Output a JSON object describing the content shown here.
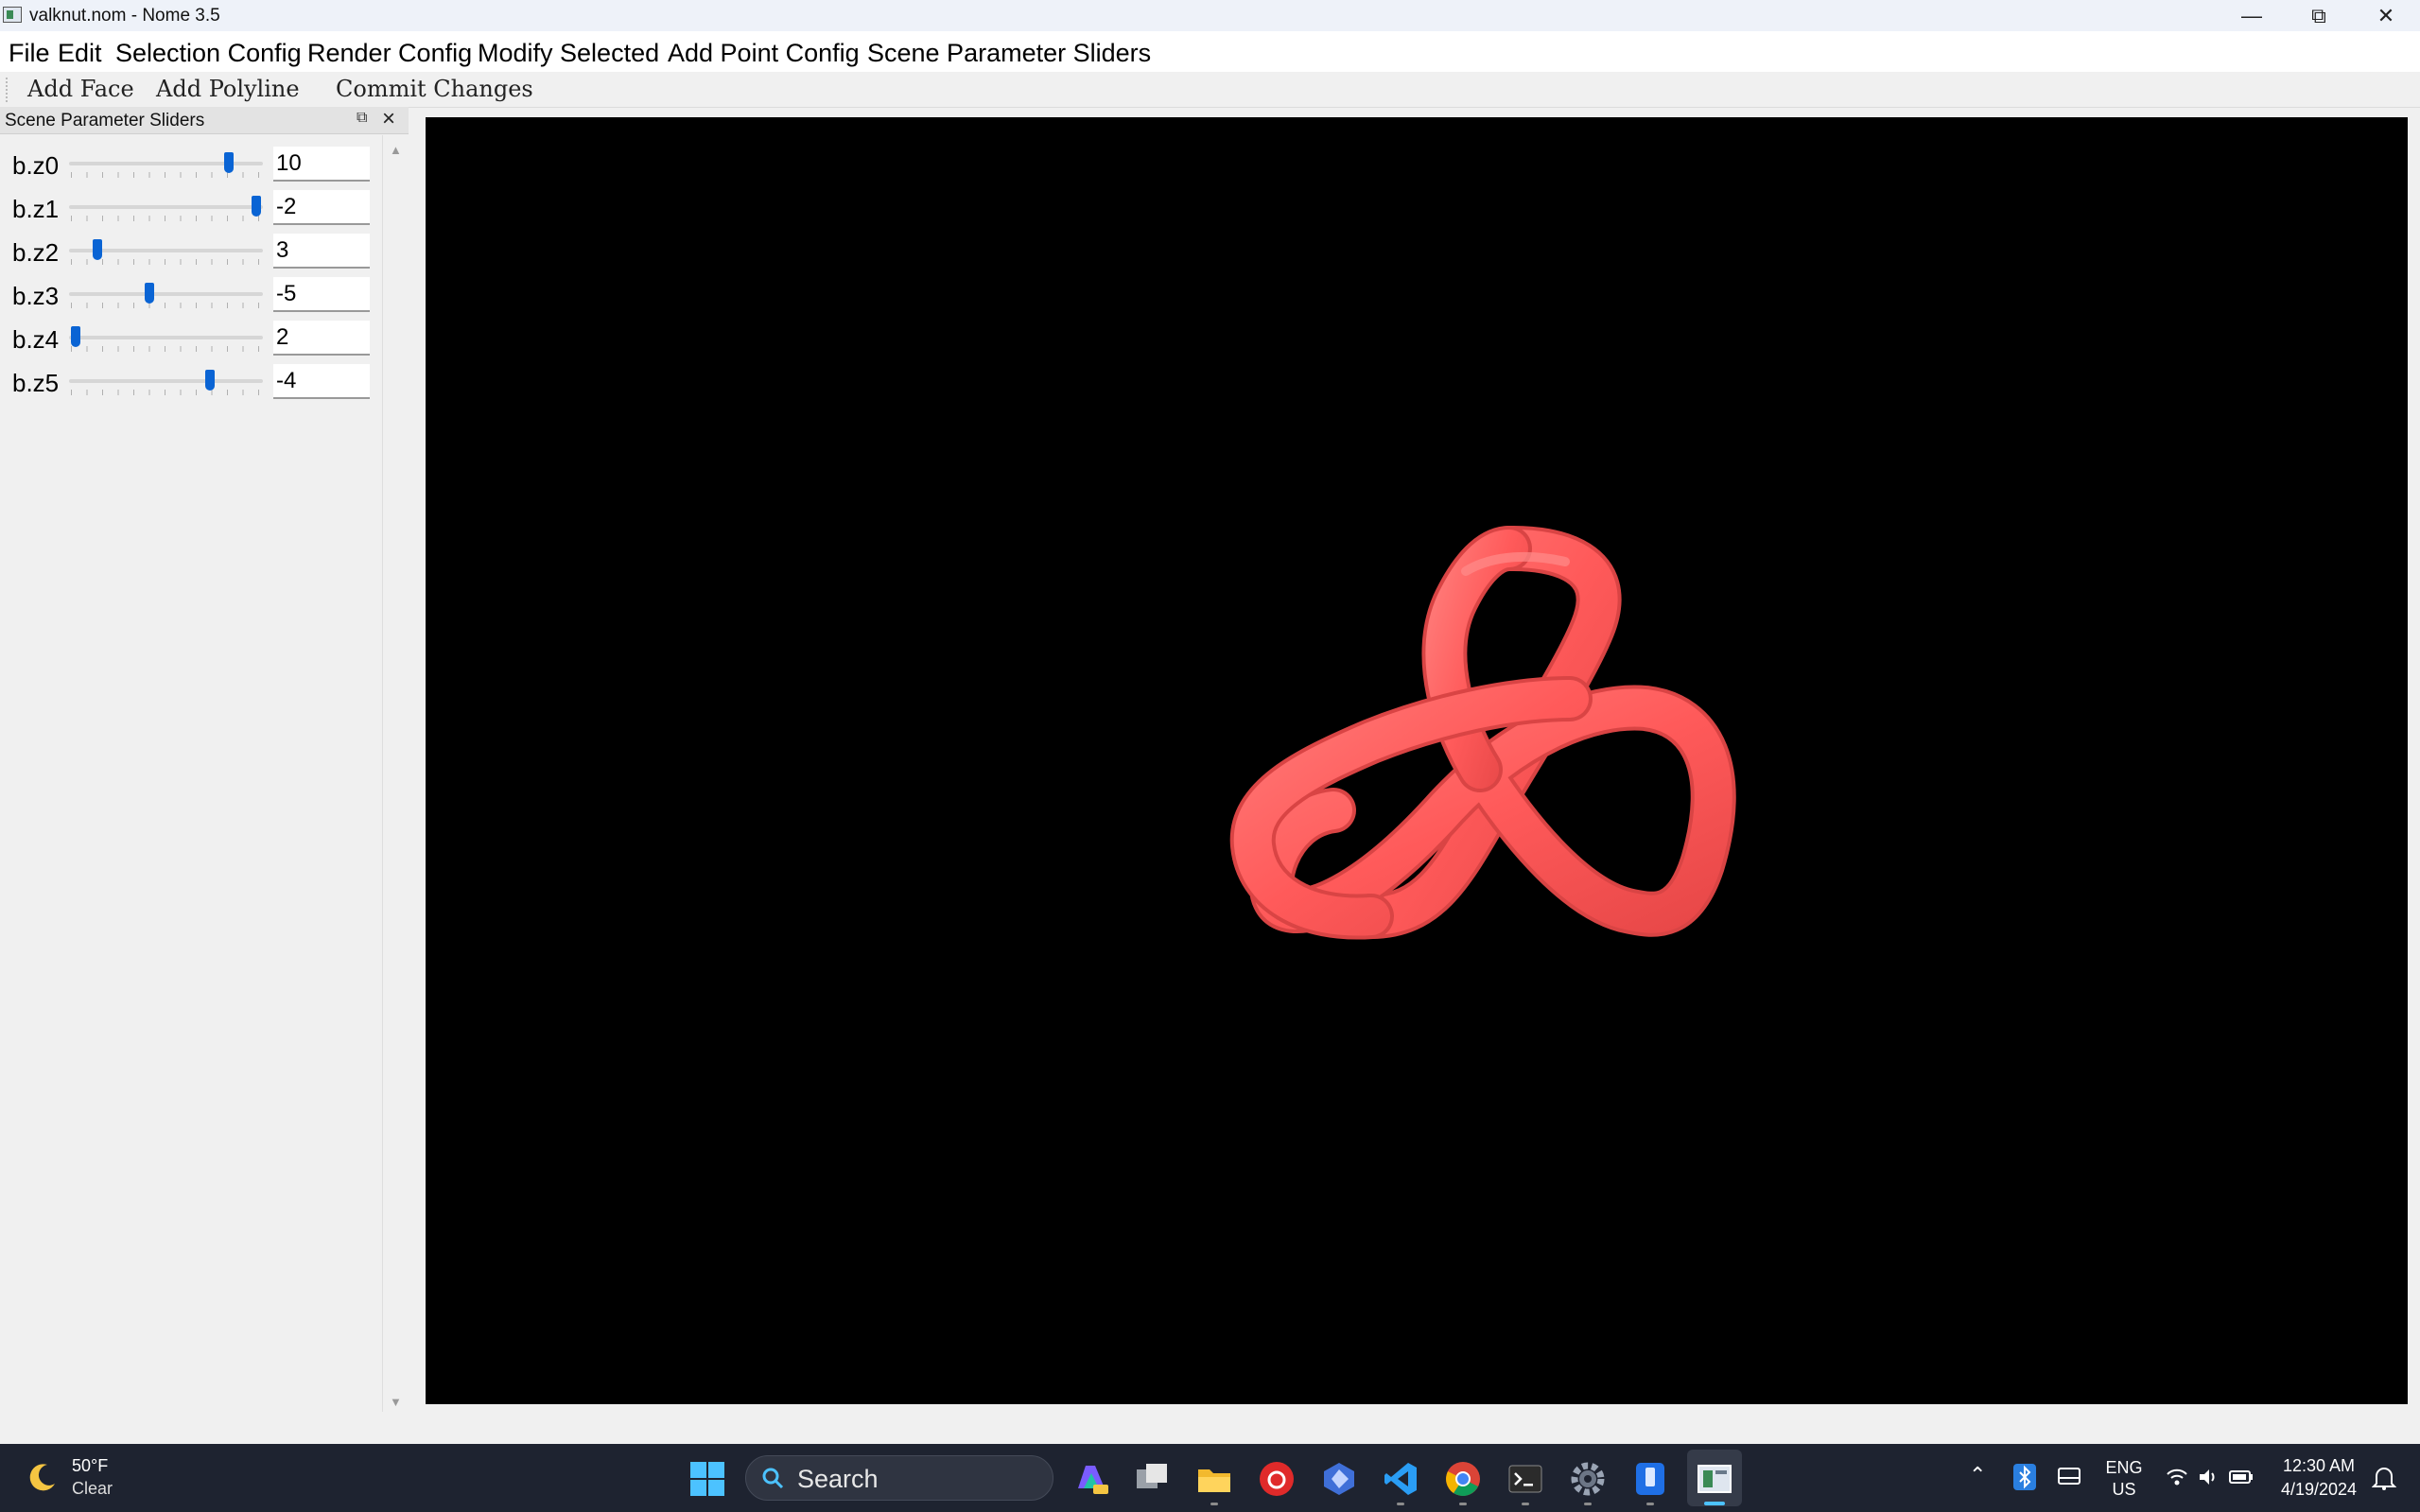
{
  "window": {
    "title": "valknut.nom - Nome 3.5"
  },
  "menubar": {
    "items": [
      "File",
      "Edit",
      "Selection Config",
      "Render Config",
      "Modify Selected",
      "Add Point Config",
      "Scene Parameter Sliders"
    ]
  },
  "toolbar": {
    "buttons": [
      "Add Face",
      "Add Polyline",
      "Commit Changes"
    ]
  },
  "slider_panel": {
    "title": "Scene Parameter Sliders",
    "sliders": [
      {
        "label": "b.z0",
        "value": "10",
        "position": 0.83
      },
      {
        "label": "b.z1",
        "value": "-2",
        "position": 0.98
      },
      {
        "label": "b.z2",
        "value": "3",
        "position": 0.12
      },
      {
        "label": "b.z3",
        "value": "-5",
        "position": 0.4
      },
      {
        "label": "b.z4",
        "value": "2",
        "position": 0.0
      },
      {
        "label": "b.z5",
        "value": "-4",
        "position": 0.73
      }
    ]
  },
  "viewport": {
    "background": "#000000",
    "mesh_color": "#ff5a5a",
    "object": "trefoil-knot"
  },
  "taskbar": {
    "weather": {
      "temp": "50°F",
      "condition": "Clear"
    },
    "search_placeholder": "Search",
    "tray": {
      "lang_top": "ENG",
      "lang_bottom": "US",
      "time": "12:30 AM",
      "date": "4/19/2024"
    },
    "accent": "#4cc2ff"
  }
}
